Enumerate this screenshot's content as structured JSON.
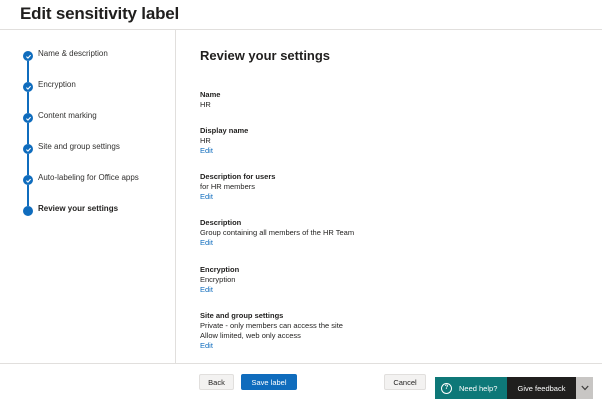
{
  "page": {
    "title": "Edit sensitivity label"
  },
  "steps": [
    {
      "label": "Name & description",
      "status": "complete"
    },
    {
      "label": "Encryption",
      "status": "complete"
    },
    {
      "label": "Content marking",
      "status": "complete"
    },
    {
      "label": "Site and group settings",
      "status": "complete"
    },
    {
      "label": "Auto-labeling for Office apps",
      "status": "complete"
    },
    {
      "label": "Review your settings",
      "status": "current"
    }
  ],
  "review": {
    "heading": "Review your settings",
    "name": {
      "label": "Name",
      "value": "HR"
    },
    "display_name": {
      "label": "Display name",
      "value": "HR",
      "edit": "Edit"
    },
    "description_users": {
      "label": "Description for users",
      "value": "for HR members",
      "edit": "Edit"
    },
    "description": {
      "label": "Description",
      "value": "Group containing all members of the HR Team",
      "edit": "Edit"
    },
    "encryption": {
      "label": "Encryption",
      "value": "Encryption",
      "edit": "Edit"
    },
    "site_group": {
      "label": "Site and group settings",
      "line1": "Private - only members can access the site",
      "line2": "Allow limited, web only access",
      "edit": "Edit"
    }
  },
  "footer": {
    "back": "Back",
    "save": "Save label",
    "cancel": "Cancel",
    "need_help": "Need help?",
    "give_feedback": "Give feedback"
  },
  "colors": {
    "accent": "#0f6cbd",
    "help_bg": "#0e7878",
    "feedback_bg": "#201f1e"
  }
}
